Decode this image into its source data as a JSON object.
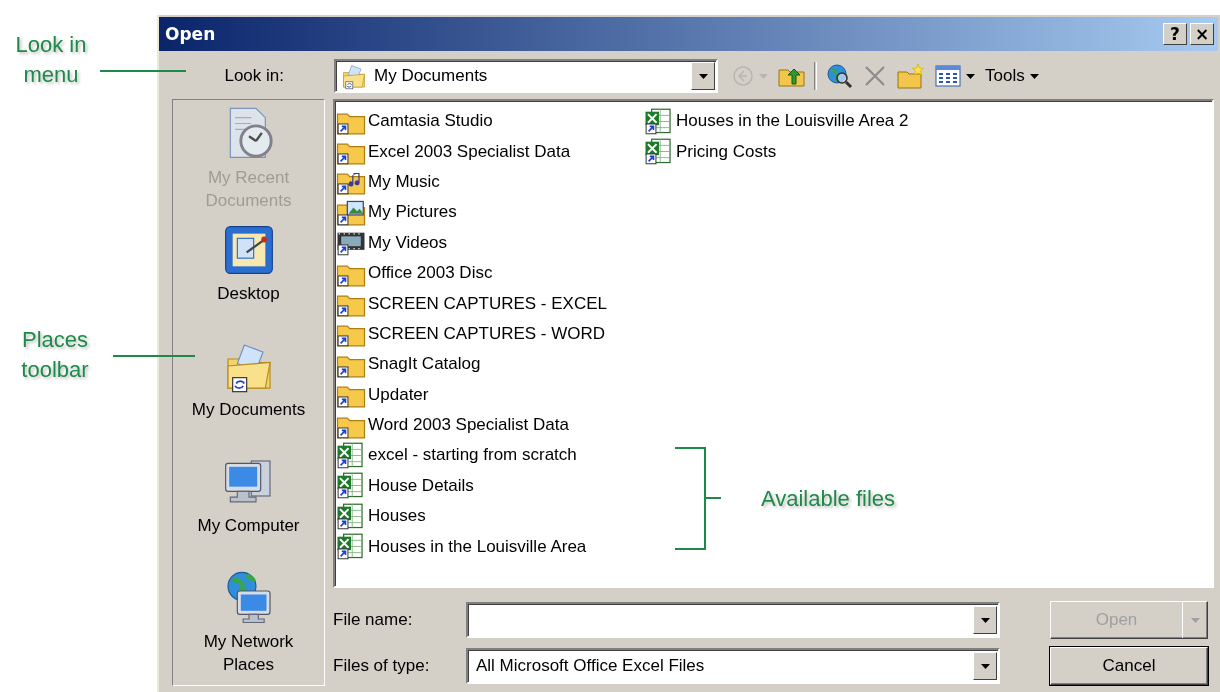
{
  "window": {
    "title": "Open",
    "help_button": "?",
    "close_button": "×"
  },
  "look_in": {
    "label": "Look in:",
    "value": "My Documents"
  },
  "toolbar": [
    {
      "kind": "back",
      "disabled": true
    },
    {
      "kind": "up",
      "disabled": false
    },
    {
      "kind": "web",
      "disabled": false
    },
    {
      "kind": "delete",
      "disabled": false
    },
    {
      "kind": "new_folder",
      "disabled": false
    },
    {
      "kind": "views",
      "disabled": false
    },
    {
      "kind": "tools",
      "label": "Tools",
      "disabled": false
    }
  ],
  "places": [
    {
      "label": "My Recent Documents",
      "kind": "recent",
      "disabled": true
    },
    {
      "label": "Desktop",
      "kind": "desktop",
      "disabled": false
    },
    {
      "label": "My Documents",
      "kind": "documents",
      "disabled": false
    },
    {
      "label": "My Computer",
      "kind": "computer",
      "disabled": false
    },
    {
      "label": "My Network Places",
      "kind": "network",
      "disabled": false
    }
  ],
  "files": [
    {
      "name": "Camtasia Studio",
      "kind": "folder"
    },
    {
      "name": "Excel 2003 Specialist Data",
      "kind": "folder"
    },
    {
      "name": "My Music",
      "kind": "music"
    },
    {
      "name": "My Pictures",
      "kind": "pictures"
    },
    {
      "name": "My Videos",
      "kind": "videos"
    },
    {
      "name": "Office 2003 Disc",
      "kind": "folder"
    },
    {
      "name": "SCREEN CAPTURES - EXCEL",
      "kind": "folder"
    },
    {
      "name": "SCREEN CAPTURES - WORD",
      "kind": "folder"
    },
    {
      "name": "SnagIt Catalog",
      "kind": "folder"
    },
    {
      "name": "Updater",
      "kind": "folder"
    },
    {
      "name": "Word 2003 Specialist Data",
      "kind": "folder"
    },
    {
      "name": "excel - starting from scratch",
      "kind": "excel"
    },
    {
      "name": "House Details",
      "kind": "excel"
    },
    {
      "name": "Houses",
      "kind": "excel"
    },
    {
      "name": "Houses in the Louisville Area",
      "kind": "excel"
    },
    {
      "name": "Houses in the Louisville Area 2",
      "kind": "excel"
    },
    {
      "name": "Pricing Costs",
      "kind": "excel"
    }
  ],
  "file_name": {
    "label": "File name:"
  },
  "files_of_type": {
    "label": "Files of type:",
    "value": "All Microsoft Office Excel Files"
  },
  "buttons": [
    {
      "label": "Open",
      "kind": "split",
      "disabled": true
    },
    {
      "label": "Cancel",
      "kind": "plain",
      "disabled": false
    }
  ],
  "annotations": [
    {
      "text": "Look in menu",
      "kind": "line"
    },
    {
      "text": "Places toolbar",
      "kind": "line"
    },
    {
      "text": "Available files",
      "kind": "bracket"
    }
  ]
}
